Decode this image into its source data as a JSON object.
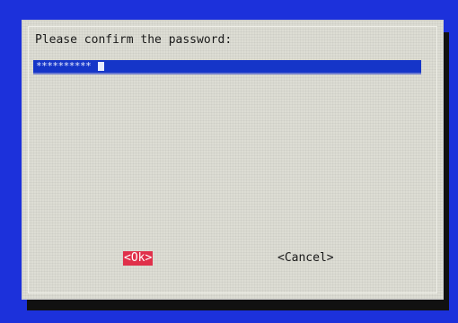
{
  "dialog": {
    "prompt": "Please confirm the password:",
    "password_mask": "**********",
    "ok_label": "<Ok>",
    "cancel_label": "<Cancel>"
  },
  "colors": {
    "background": "#1c31db",
    "dialog": "#ddddd4",
    "field": "#1535c8",
    "focused_button": "#e0304a"
  }
}
